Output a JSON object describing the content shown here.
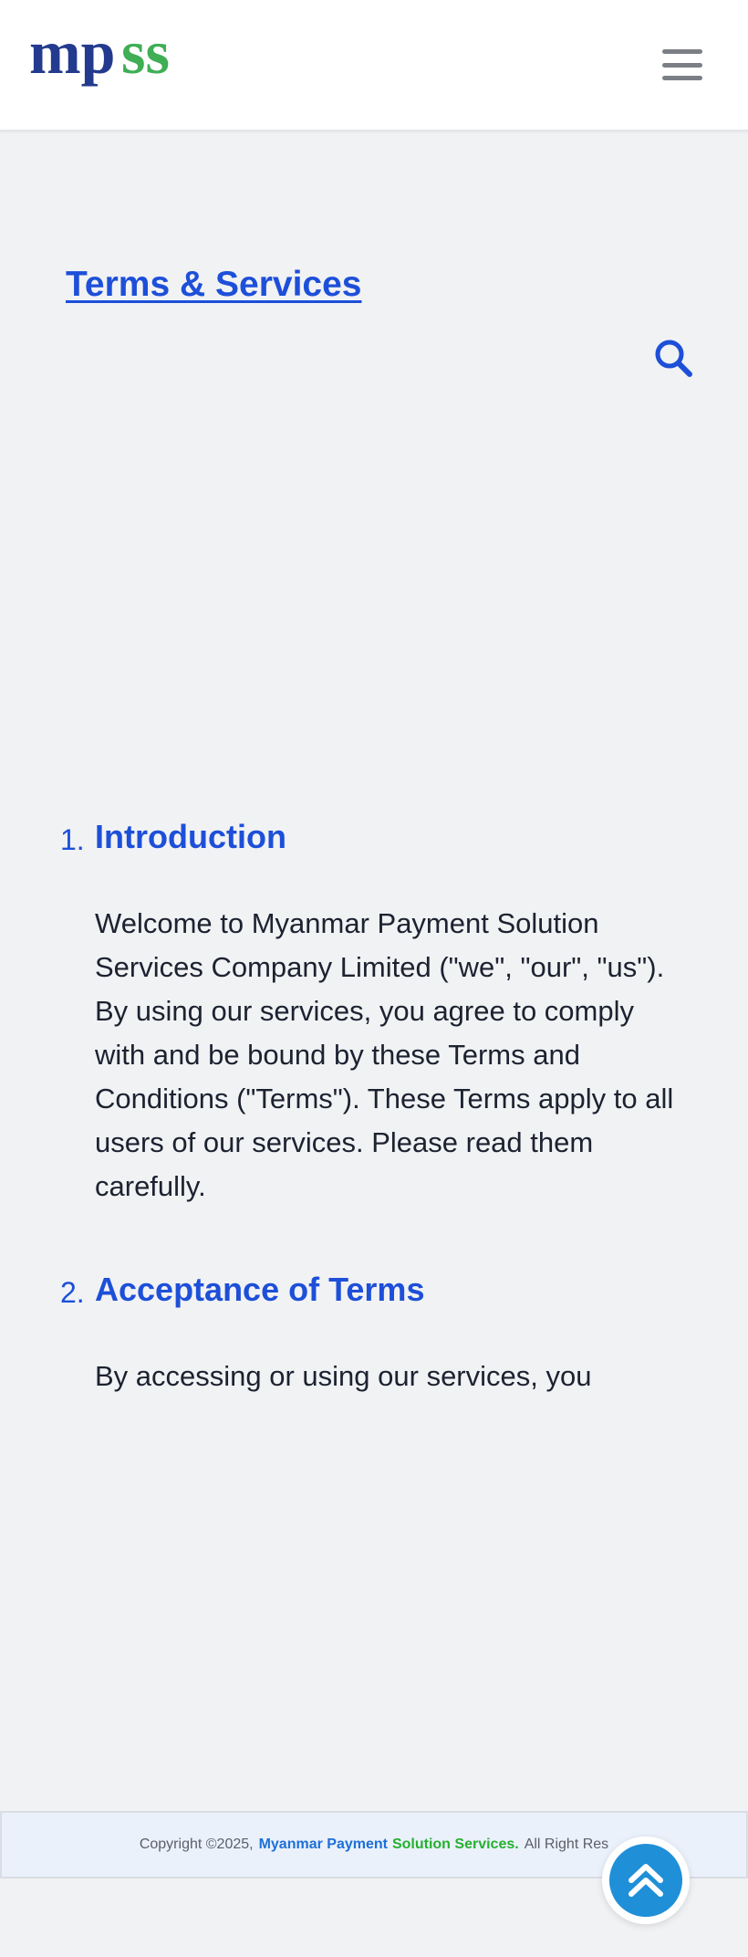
{
  "header": {
    "logo_parts": {
      "mp": "mp",
      "ss": "ss"
    },
    "logo_colors": {
      "mp": "#233a8e",
      "ss": "#3fae55"
    },
    "menu_icon": "hamburger-menu-icon"
  },
  "main": {
    "title": "Terms & Services",
    "search_icon": "search-icon",
    "sections": [
      {
        "number": "1.",
        "heading": "Introduction",
        "body": "Welcome to Myanmar Payment Solution Services Company Limited (\"we\", \"our\", \"us\"). By using our services, you agree to comply with and be bound by these Terms and Conditions (\"Terms\"). These Terms apply to all users of our services. Please read them carefully."
      },
      {
        "number": "2.",
        "heading": "Acceptance of Terms",
        "body": "By accessing or using our services, you"
      }
    ]
  },
  "footer": {
    "copyright": "Copyright ©2025,",
    "brand_part1": "Myanmar Payment",
    "brand_part2": "Solution Services.",
    "rights": "All Right Res"
  },
  "back_to_top_icon": "double-chevron-up-icon",
  "colors": {
    "accent": "#1d4fd8",
    "background": "#f1f2f4",
    "footer_bg": "#eaf1fb",
    "back_to_top": "#1f8fd8"
  }
}
